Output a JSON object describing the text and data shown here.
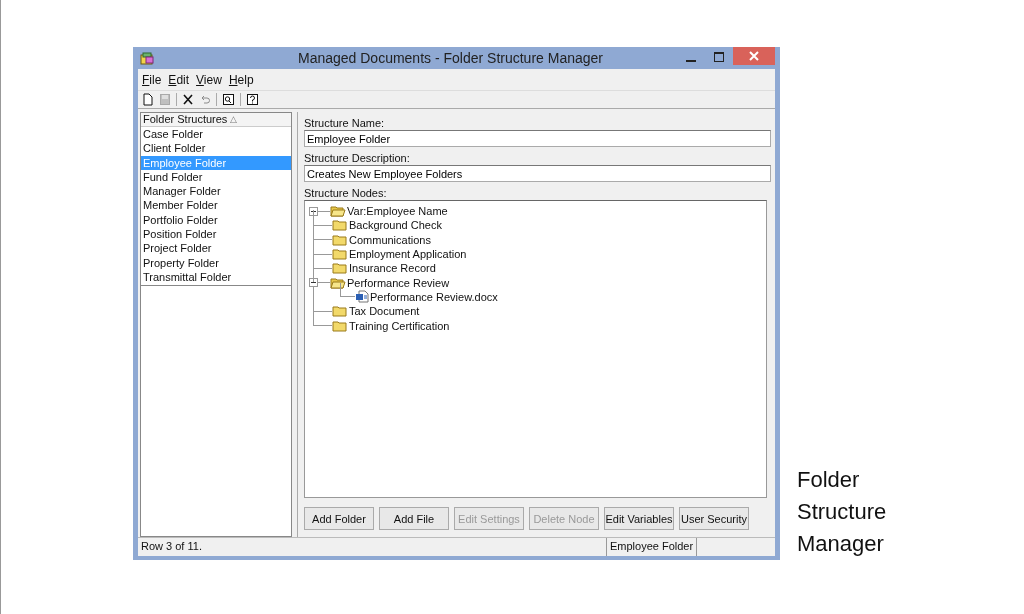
{
  "window": {
    "title": "Managed Documents - Folder Structure Manager"
  },
  "menu": [
    {
      "label": "File"
    },
    {
      "label": "Edit"
    },
    {
      "label": "View"
    },
    {
      "label": "Help"
    }
  ],
  "toolbar": [
    {
      "kind": "new",
      "disabled": false
    },
    {
      "kind": "save",
      "disabled": true
    },
    {
      "kind": "sep"
    },
    {
      "kind": "delete",
      "disabled": false
    },
    {
      "kind": "undo",
      "disabled": true
    },
    {
      "kind": "sep"
    },
    {
      "kind": "find",
      "disabled": false
    },
    {
      "kind": "sep"
    },
    {
      "kind": "help",
      "disabled": false
    }
  ],
  "list": {
    "header": "Folder Structures",
    "sort_glyph": "△",
    "items": [
      {
        "label": "Case Folder",
        "selected": false
      },
      {
        "label": "Client Folder",
        "selected": false
      },
      {
        "label": "Employee Folder",
        "selected": true
      },
      {
        "label": "Fund Folder",
        "selected": false
      },
      {
        "label": "Manager Folder",
        "selected": false
      },
      {
        "label": "Member Folder",
        "selected": false
      },
      {
        "label": "Portfolio Folder",
        "selected": false
      },
      {
        "label": "Position Folder",
        "selected": false
      },
      {
        "label": "Project Folder",
        "selected": false
      },
      {
        "label": "Property Folder",
        "selected": false
      },
      {
        "label": "Transmittal Folder",
        "selected": false
      }
    ]
  },
  "form": {
    "name_label": "Structure Name:",
    "name_value": "Employee Folder",
    "description_label": "Structure Description:",
    "description_value": "Creates New Employee Folders",
    "nodes_label": "Structure Nodes:"
  },
  "tree": [
    {
      "label": "Var:Employee Name",
      "kind": "open-folder",
      "expanded": true,
      "children": [
        {
          "label": "Background Check",
          "kind": "folder"
        },
        {
          "label": "Communications",
          "kind": "folder"
        },
        {
          "label": "Employment Application",
          "kind": "folder"
        },
        {
          "label": "Insurance Record",
          "kind": "folder"
        },
        {
          "label": "Performance Review",
          "kind": "open-folder",
          "expanded": true,
          "children": [
            {
              "label": "Performance Review.docx",
              "kind": "file"
            }
          ]
        },
        {
          "label": "Tax Document",
          "kind": "folder"
        },
        {
          "label": "Training Certification",
          "kind": "folder"
        }
      ]
    }
  ],
  "buttons": [
    {
      "label": "Add Folder",
      "disabled": false
    },
    {
      "label": "Add File",
      "disabled": false
    },
    {
      "label": "Edit Settings",
      "disabled": true
    },
    {
      "label": "Delete Node",
      "disabled": true
    },
    {
      "label": "Edit Variables",
      "disabled": false
    },
    {
      "label": "User Security",
      "disabled": false
    }
  ],
  "status_bar": {
    "message": "Row 3 of 11.",
    "panel_2": "Employee Folder"
  },
  "caption": "Folder Structure Manager"
}
